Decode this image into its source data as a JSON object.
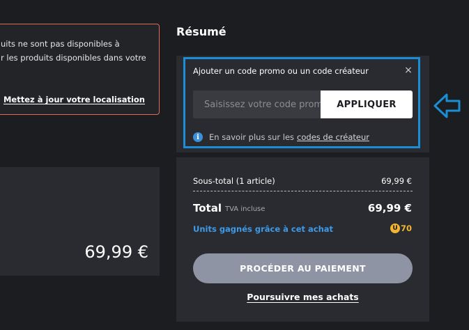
{
  "warning": {
    "line1": "uits ne sont pas disponibles à",
    "line2": "r les produits disponibles dans votre",
    "link": "Mettez à jour votre localisation",
    "border_color": "#e46a4f"
  },
  "product": {
    "price": "69,99 €"
  },
  "summary": {
    "title": "Résumé"
  },
  "promo": {
    "title": "Ajouter un code promo ou un code créateur",
    "close_icon": "×",
    "input_placeholder": "Saisissez votre code promo",
    "apply_label": "APPLIQUER",
    "info_icon": "i",
    "info_text": "En savoir plus sur les",
    "info_link": "codes de créateur",
    "highlight_color": "#1a8fd6"
  },
  "totals": {
    "subtotal_label": "Sous-total (1 article)",
    "subtotal_value": "69,99 €",
    "total_label": "Total",
    "tva_label": "TVA incluse",
    "total_value": "69,99 €",
    "units_label": "Units gagnés grâce à cet achat",
    "units_icon": "U",
    "units_value": "70",
    "checkout_label": "PROCÉDER AU PAIEMENT",
    "continue_label": "Poursuivre mes achats",
    "units_color": "#3e9be8",
    "coin_color": "#f2b531"
  },
  "annotation": {
    "arrow_icon": "arrow-left-outline",
    "arrow_color": "#1a8fd6"
  }
}
